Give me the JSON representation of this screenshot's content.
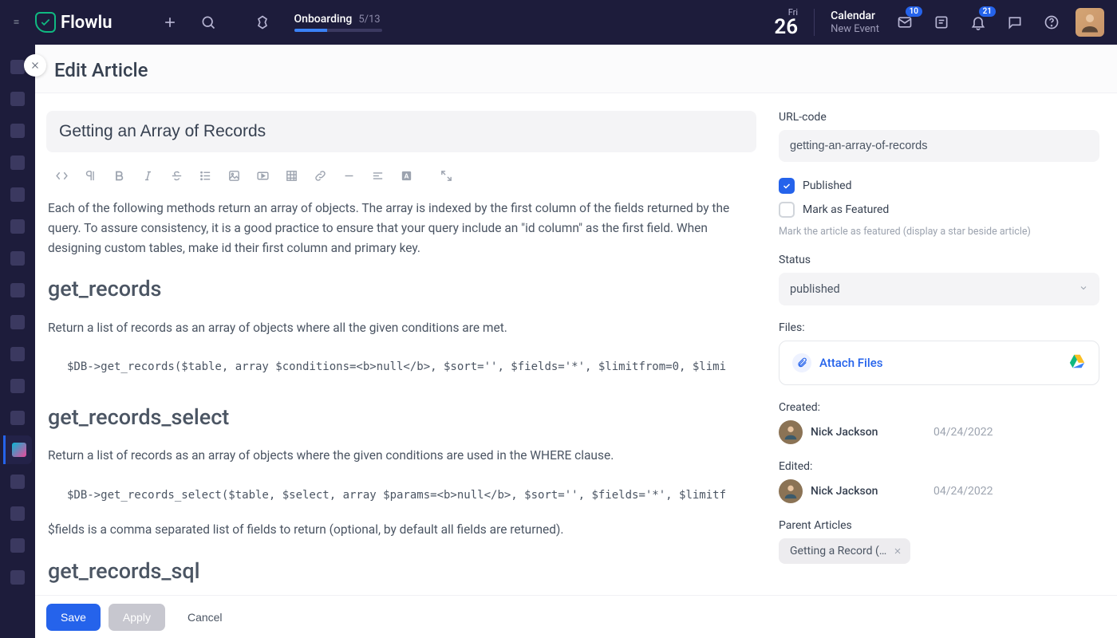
{
  "brand": "Flowlu",
  "onboarding": {
    "title": "Onboarding",
    "count": "5/13"
  },
  "date": {
    "day": "Fri",
    "num": "26"
  },
  "calendar": {
    "title": "Calendar",
    "sub": "New Event"
  },
  "badges": {
    "inbox": "10",
    "bell": "21"
  },
  "page": {
    "title": "Edit Article"
  },
  "article": {
    "title": "Getting an Array of Records",
    "para1": "Each of the following methods return an array of objects. The array is indexed by the first column of the fields returned by the query. To assure consistency, it is a good practice to ensure that your query include an \"id column\" as the first field. When designing custom tables, make id their first column and primary key.",
    "h1": "get_records",
    "para2": "Return a list of records as an array of objects where all the given conditions are met.",
    "code1": "$DB->get_records($table, array $conditions=<b>null</b>, $sort='', $fields='*', $limitfrom=0, $limi",
    "h2": "get_records_select",
    "para3": "Return a list of records as an array of objects where the given conditions are used in the WHERE clause.",
    "code2": "$DB->get_records_select($table, $select, array $params=<b>null</b>, $sort='', $fields='*', $limitf",
    "para4": "$fields is a comma separated list of fields to return (optional, by default all fields are returned).",
    "h3": "get_records_sql"
  },
  "side": {
    "url_label": "URL-code",
    "url_value": "getting-an-array-of-records",
    "published_label": "Published",
    "featured_label": "Mark as Featured",
    "featured_hint": "Mark the article as featured (display a star beside article)",
    "status_label": "Status",
    "status_value": "published",
    "files_label": "Files:",
    "attach_label": "Attach Files",
    "created_label": "Created:",
    "created_user": "Nick Jackson",
    "created_date": "04/24/2022",
    "edited_label": "Edited:",
    "edited_user": "Nick Jackson",
    "edited_date": "04/24/2022",
    "parent_label": "Parent Articles",
    "parent_chip": "Getting a Record (…"
  },
  "footer": {
    "save": "Save",
    "apply": "Apply",
    "cancel": "Cancel"
  }
}
